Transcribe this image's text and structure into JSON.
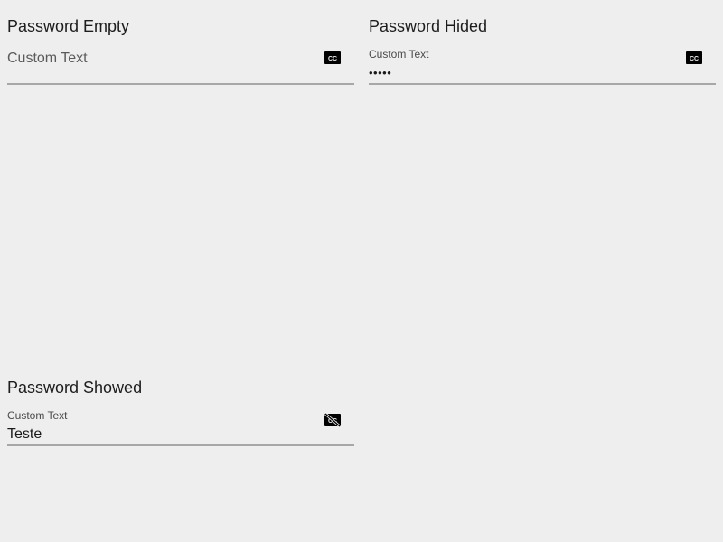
{
  "fields": [
    {
      "title": "Password Empty",
      "label": "Custom Text",
      "value": "",
      "toggle_icon": "closed-caption-icon"
    },
    {
      "title": "Password Hided",
      "label": "Custom Text",
      "value": "•••••",
      "toggle_icon": "closed-caption-icon"
    },
    {
      "title": "Password Showed",
      "label": "Custom Text",
      "value": "Teste",
      "toggle_icon": "closed-caption-disabled-icon"
    }
  ],
  "colors": {
    "background": "#eeeeee",
    "underline": "#a7a7a7",
    "icon": "#000000"
  }
}
